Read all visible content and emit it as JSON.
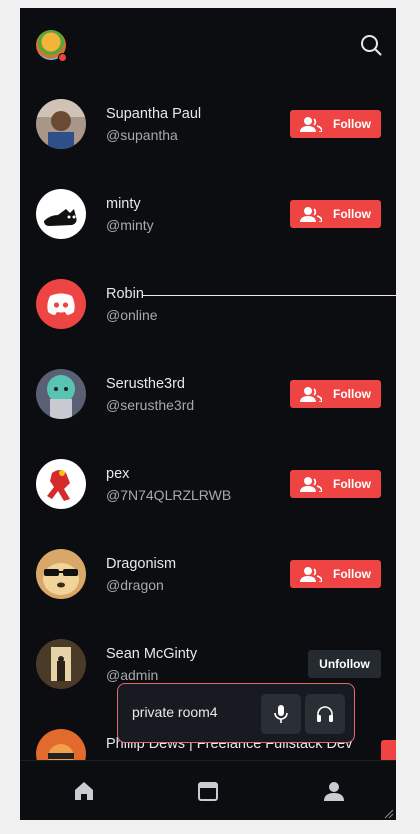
{
  "header": {
    "avatar_icon": "burger-avatar-icon",
    "search_icon": "search-icon"
  },
  "users": [
    {
      "name": "Supantha Paul",
      "handle": "@supantha",
      "action": "Follow"
    },
    {
      "name": "minty",
      "handle": "@minty",
      "action": "Follow"
    },
    {
      "name": "Robin",
      "handle": "@online",
      "action": ""
    },
    {
      "name": "Serusthe3rd",
      "handle": "@serusthe3rd",
      "action": "Follow"
    },
    {
      "name": "pex",
      "handle": "@7N74QLRZLRWB",
      "action": "Follow"
    },
    {
      "name": "Dragonism",
      "handle": "@dragon",
      "action": "Follow"
    },
    {
      "name": "Sean McGinty",
      "handle": "@admin",
      "action": "Unfollow"
    },
    {
      "name": "Phillip Dews | Freelance Fullstack Dev",
      "handle": "",
      "action": ""
    }
  ],
  "room_popup": {
    "name": "private room4",
    "mic_icon": "mic-icon",
    "headphones_icon": "headphones-icon"
  },
  "nav": {
    "home_icon": "home-icon",
    "calendar_icon": "calendar-icon",
    "profile_icon": "profile-icon"
  },
  "colors": {
    "background": "#0b0d11",
    "accent": "#ef4444",
    "secondary_button": "#252a30"
  }
}
